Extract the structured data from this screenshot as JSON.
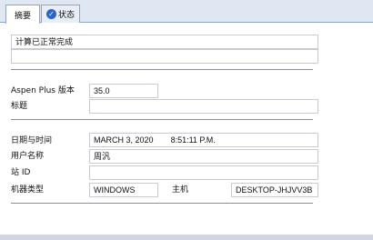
{
  "tabs": {
    "summary": "摘要",
    "status": "状态"
  },
  "summary": {
    "message": "计算已正常完成",
    "message_line2": ""
  },
  "info": {
    "version_label": "Aspen Plus 版本",
    "version_value": "35.0",
    "title_label": "标题",
    "title_value": ""
  },
  "run": {
    "datetime_label": "日期与时间",
    "date_value": "MARCH 3, 2020",
    "time_value": "8:51:11 P.M.",
    "user_label": "用户名称",
    "user_value": "周汎",
    "station_label": "站 ID",
    "station_value": "",
    "machine_type_label": "机器类型",
    "machine_type_value": "WINDOWS",
    "host_label": "主机",
    "host_value": "DESKTOP-JHJVV3B"
  },
  "colors": {
    "tab_bar_bg": "#dfe7f3",
    "status_icon": "#2b65c9"
  },
  "icons": {
    "status_tab_icon": "check-icon"
  }
}
